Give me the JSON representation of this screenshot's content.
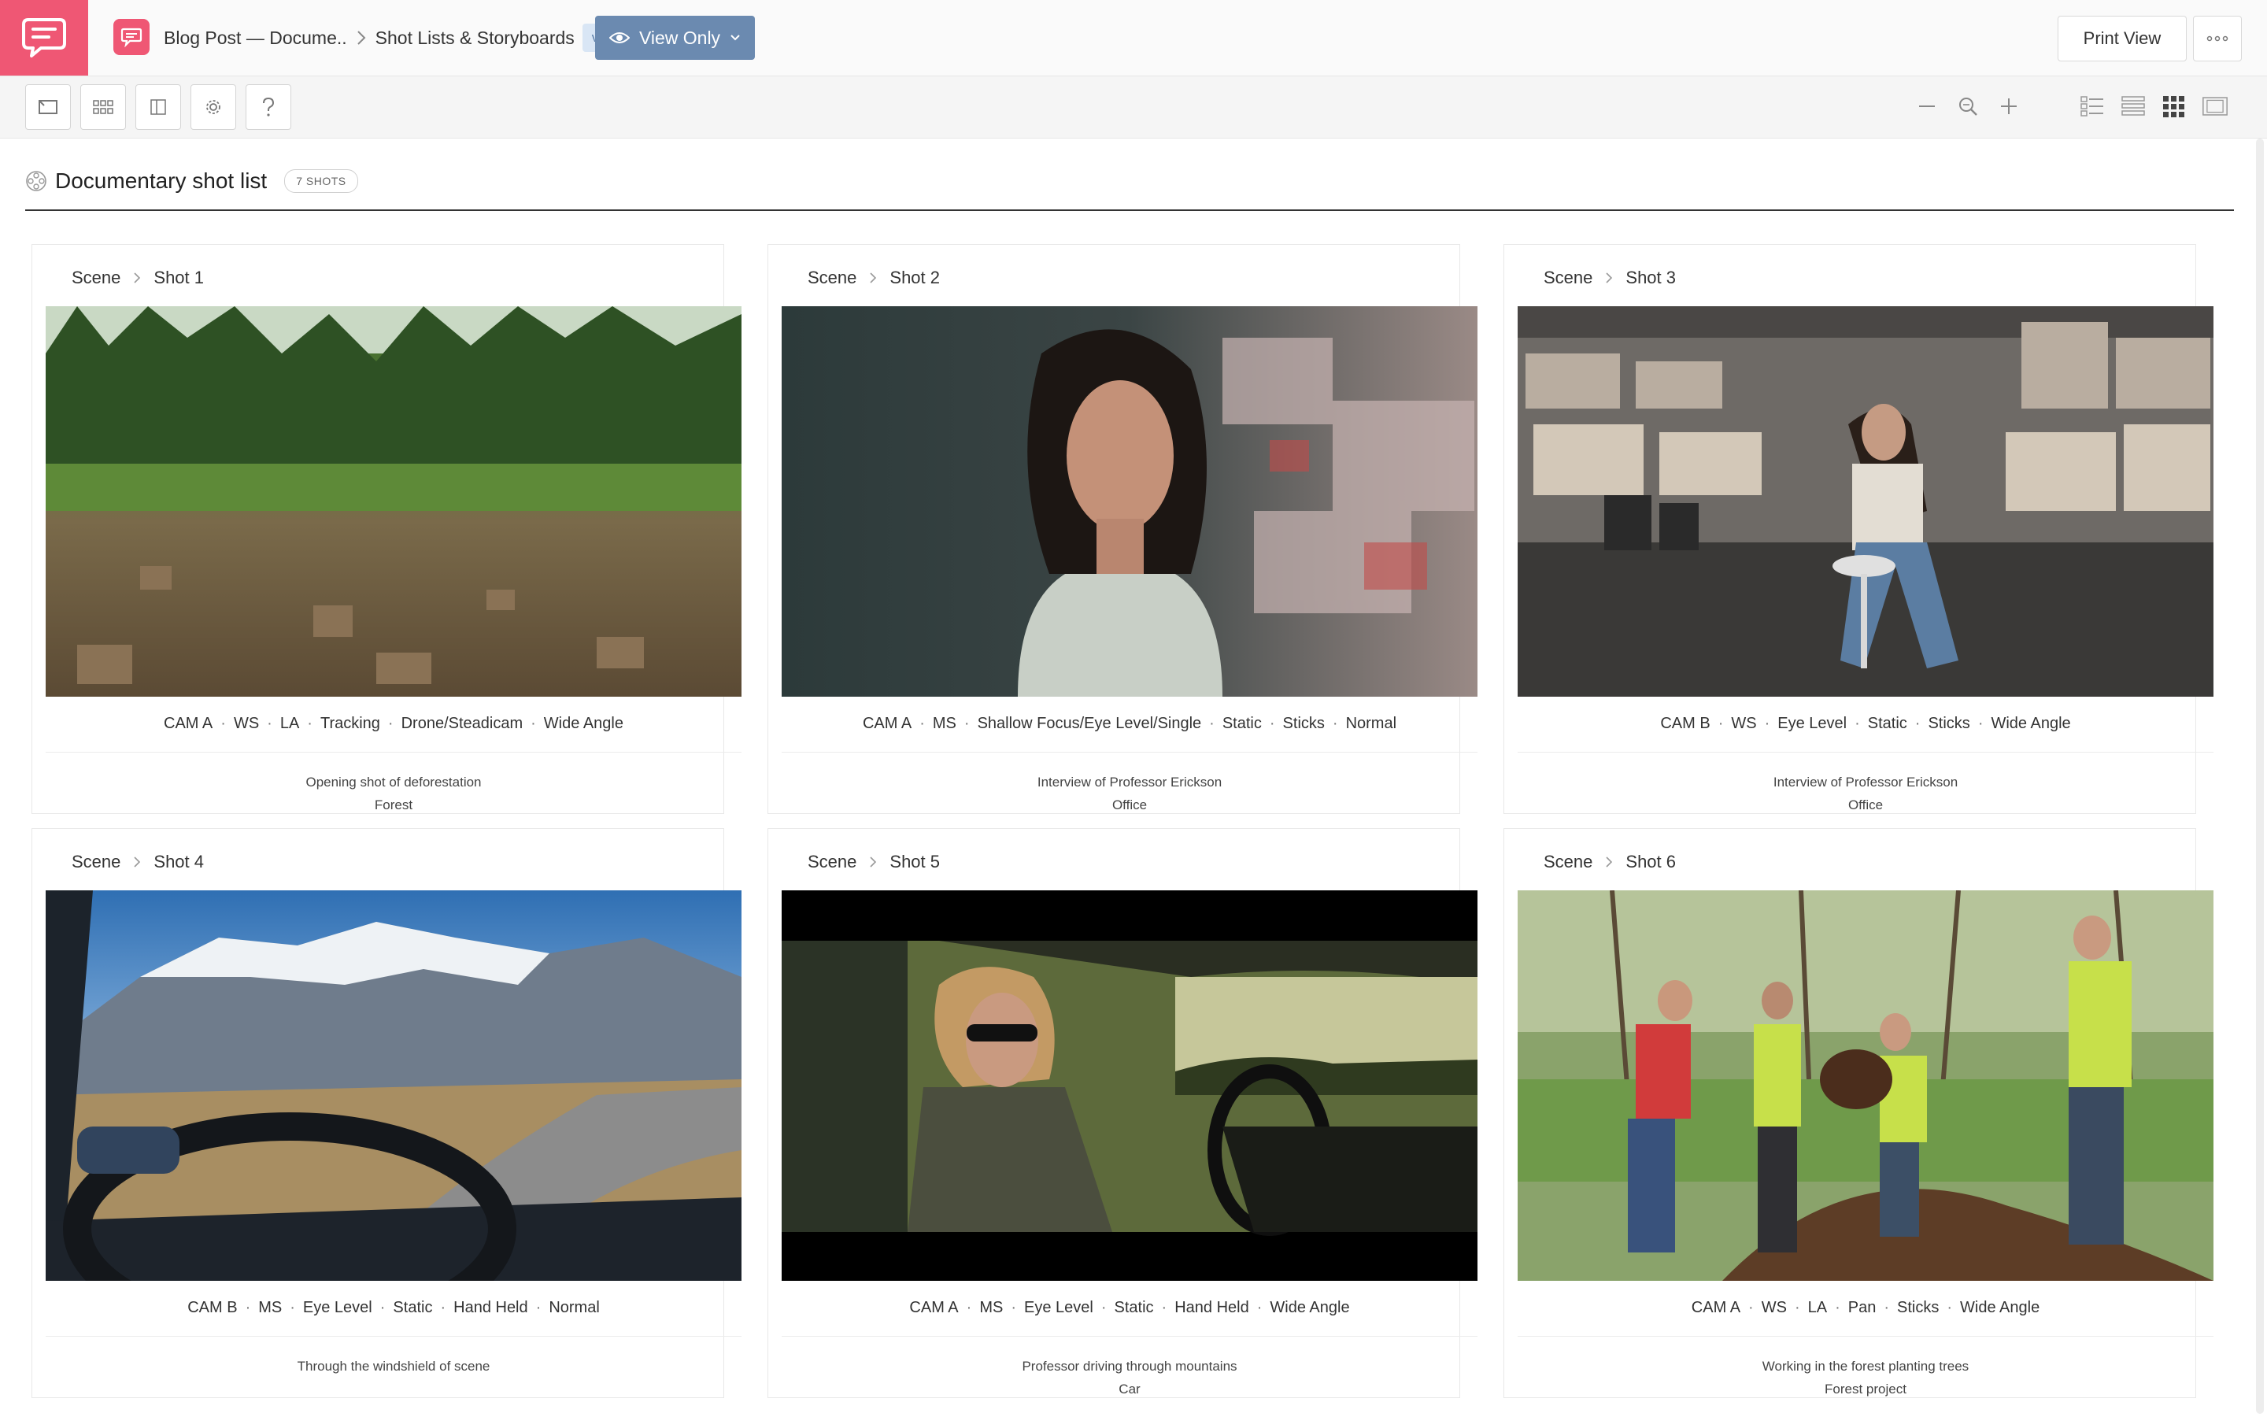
{
  "header": {
    "breadcrumbs": [
      "Blog Post — Docume..",
      "Shot Lists & Storyboards"
    ],
    "version": "v0",
    "view_mode": "View Only",
    "print_view": "Print View"
  },
  "list": {
    "title": "Documentary shot list",
    "shot_count": "7 SHOTS"
  },
  "shots": [
    {
      "scene": "Scene",
      "shot": "Shot 1",
      "meta": [
        "CAM A",
        "WS",
        "LA",
        "Tracking",
        "Drone/Steadicam",
        "Wide Angle"
      ],
      "desc": "Opening shot of deforestation",
      "location": "Forest"
    },
    {
      "scene": "Scene",
      "shot": "Shot 2",
      "meta": [
        "CAM A",
        "MS",
        "Shallow Focus/Eye Level/Single",
        "Static",
        "Sticks",
        "Normal"
      ],
      "desc": "Interview of Professor Erickson",
      "location": "Office"
    },
    {
      "scene": "Scene",
      "shot": "Shot 3",
      "meta": [
        "CAM B",
        "WS",
        "Eye Level",
        "Static",
        "Sticks",
        "Wide Angle"
      ],
      "desc": "Interview of Professor Erickson",
      "location": "Office"
    },
    {
      "scene": "Scene",
      "shot": "Shot 4",
      "meta": [
        "CAM B",
        "MS",
        "Eye Level",
        "Static",
        "Hand Held",
        "Normal"
      ],
      "desc": "Through the windshield of scene",
      "location": ""
    },
    {
      "scene": "Scene",
      "shot": "Shot 5",
      "meta": [
        "CAM A",
        "MS",
        "Eye Level",
        "Static",
        "Hand Held",
        "Wide Angle"
      ],
      "desc": "Professor driving through mountains",
      "location": "Car"
    },
    {
      "scene": "Scene",
      "shot": "Shot 6",
      "meta": [
        "CAM A",
        "WS",
        "LA",
        "Pan",
        "Sticks",
        "Wide Angle"
      ],
      "desc": "Working in the forest planting trees",
      "location": "Forest project"
    }
  ],
  "colors": {
    "brand": "#ef5774",
    "view_button": "#6b8ab0",
    "version_badge": "#d9e6f5"
  }
}
